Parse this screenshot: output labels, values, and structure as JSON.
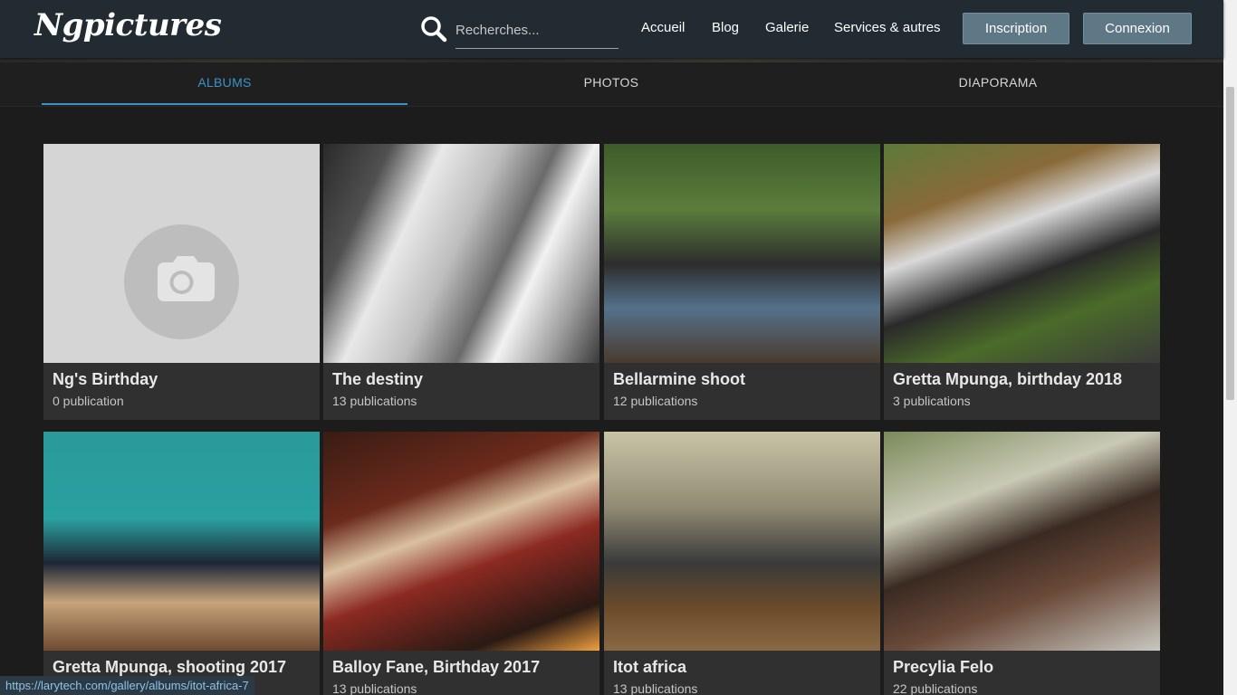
{
  "header": {
    "logo": "Ngpictures",
    "search_placeholder": "Recherches...",
    "nav": [
      "Accueil",
      "Blog",
      "Galerie",
      "Services & autres"
    ],
    "signup_label": "Inscription",
    "login_label": "Connexion"
  },
  "tabs": [
    {
      "label": "ALBUMS",
      "active": true
    },
    {
      "label": "PHOTOS",
      "active": false
    },
    {
      "label": "DIAPORAMA",
      "active": false
    }
  ],
  "albums": [
    {
      "title": "Ng's Birthday",
      "count": "0 publication",
      "image": "camera-placeholder"
    },
    {
      "title": "The destiny",
      "count": "13 publications",
      "image": "bw-balcony-bicycle-photo"
    },
    {
      "title": "Bellarmine shoot",
      "count": "12 publications",
      "image": "group-portrait-photo"
    },
    {
      "title": "Gretta Mpunga, birthday 2018",
      "count": "3 publications",
      "image": "party-garden-photo"
    },
    {
      "title": "Gretta Mpunga, shooting 2017",
      "count": "",
      "image": "girl-with-puppy-photo"
    },
    {
      "title": "Balloy Fane, Birthday 2017",
      "count": "13 publications",
      "image": "candles-photo"
    },
    {
      "title": "Itot africa",
      "count": "13 publications",
      "image": "office-laptop-photo"
    },
    {
      "title": "Precylia Felo",
      "count": "22 publications",
      "image": "portrait-photo"
    }
  ],
  "status_url": "https://larytech.com/gallery/albums/itot-africa-7",
  "colors": {
    "header_bg": "#212b31",
    "page_bg": "#1c1c1c",
    "accent": "#3a94c9",
    "button_bg": "#5e7886",
    "caption_bg": "#303030"
  }
}
